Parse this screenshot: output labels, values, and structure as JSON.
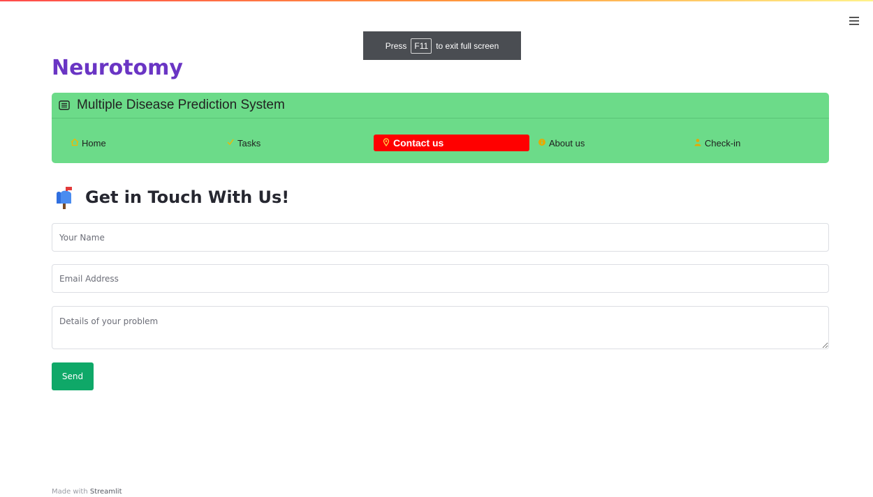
{
  "toast": {
    "press": "Press",
    "key": "F11",
    "rest": "to exit full screen"
  },
  "app": {
    "brand": "Neurotomy"
  },
  "menu": {
    "title": "Multiple Disease Prediction System",
    "items": [
      {
        "label": "Home",
        "icon": "house-icon"
      },
      {
        "label": "Tasks",
        "icon": "tasks-icon"
      },
      {
        "label": "Contact us",
        "icon": "pin-icon",
        "active": true
      },
      {
        "label": "About us",
        "icon": "info-icon"
      },
      {
        "label": "Check-in",
        "icon": "person-icon"
      }
    ]
  },
  "form": {
    "heading": "Get in Touch With Us!",
    "name_placeholder": "Your Name",
    "email_placeholder": "Email Address",
    "details_placeholder": "Details of your problem",
    "send_label": "Send"
  },
  "footer": {
    "made_with": "Made with",
    "link": "Streamlit"
  },
  "colors": {
    "brand": "#6a35c4",
    "menu_bg": "#6cdb89",
    "active_tab": "#ff0000",
    "send": "#0fa868"
  }
}
